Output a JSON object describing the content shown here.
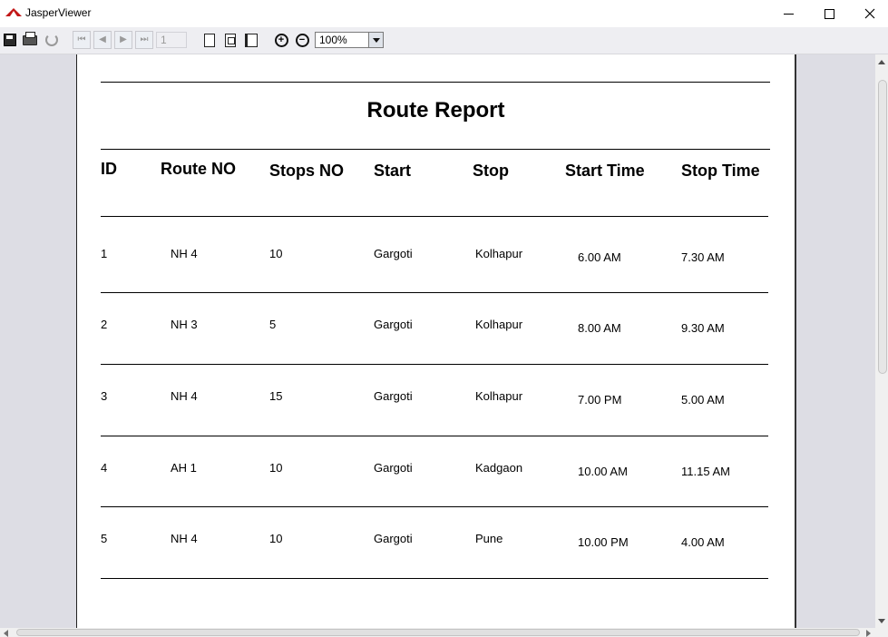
{
  "window": {
    "title": "JasperViewer",
    "icon": "jasper-logo-icon",
    "controls": [
      "minimize-icon",
      "maximize-icon",
      "close-icon"
    ]
  },
  "toolbar": {
    "buttons": [
      "save-icon",
      "print-icon",
      "reload-icon",
      "first-page-icon",
      "previous-page-icon",
      "next-page-icon",
      "last-page-icon",
      "actual-size-icon",
      "fit-page-icon",
      "fit-width-icon",
      "zoom-in-icon",
      "zoom-out-icon"
    ],
    "page_number": "1",
    "zoom": "100%"
  },
  "report": {
    "title": "Route Report",
    "columns": [
      "ID",
      "Route NO",
      "Stops NO",
      "Start",
      "Stop",
      "Start Time",
      "Stop Time"
    ],
    "rows": [
      [
        "1",
        "NH 4",
        "10",
        "Gargoti",
        "Kolhapur",
        "6.00 AM",
        "7.30 AM"
      ],
      [
        "2",
        "NH 3",
        "5",
        "Gargoti",
        "Kolhapur",
        "8.00 AM",
        "9.30 AM"
      ],
      [
        "3",
        "NH 4",
        "15",
        "Gargoti",
        "Kolhapur",
        "7.00 PM",
        "5.00 AM"
      ],
      [
        "4",
        "AH 1",
        "10",
        "Gargoti",
        "Kadgaon",
        "10.00 AM",
        "11.15 AM"
      ],
      [
        "5",
        "NH 4",
        "10",
        "Gargoti",
        "Pune",
        "10.00 PM",
        "4.00 AM"
      ]
    ]
  }
}
